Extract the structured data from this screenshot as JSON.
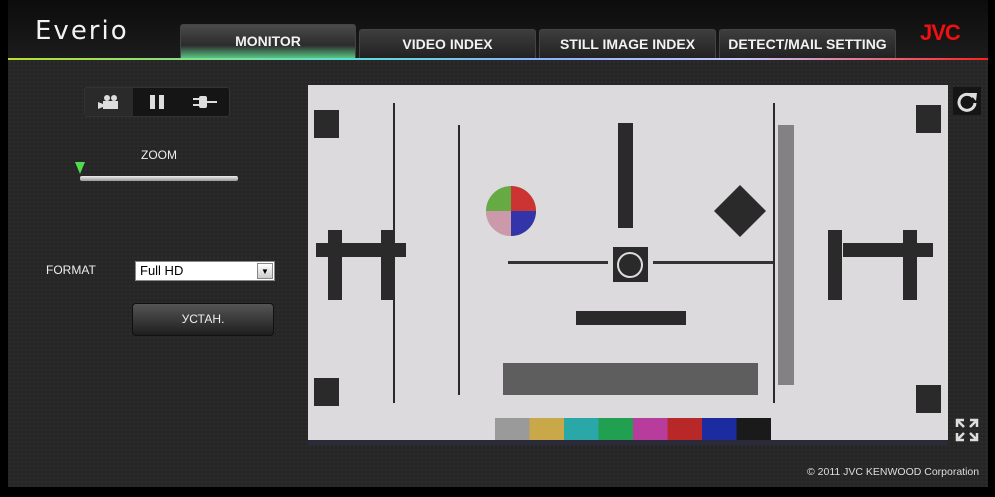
{
  "header": {
    "logo": "Everio",
    "brand": "JVC",
    "tabs": [
      {
        "label": "MONITOR",
        "active": true
      },
      {
        "label": "VIDEO INDEX"
      },
      {
        "label": "STILL IMAGE INDEX"
      },
      {
        "label": "DETECT/MAIL SETTING"
      }
    ]
  },
  "controls": {
    "icons": [
      "video-camera-icon",
      "pause-icon",
      "plug-icon"
    ]
  },
  "zoom": {
    "label": "ZOOM",
    "level": 0
  },
  "format": {
    "label": "FORMAT",
    "value": "Full HD"
  },
  "set_button": "УСТАН.",
  "video": {
    "color_bars": [
      "#9a9a9a",
      "#c8a848",
      "#2aa8a8",
      "#20a050",
      "#b83c9c",
      "#b82828",
      "#1c2ca0",
      "#1a1a1a"
    ]
  },
  "footer": {
    "copyright": "© 2011 JVC KENWOOD Corporation"
  }
}
